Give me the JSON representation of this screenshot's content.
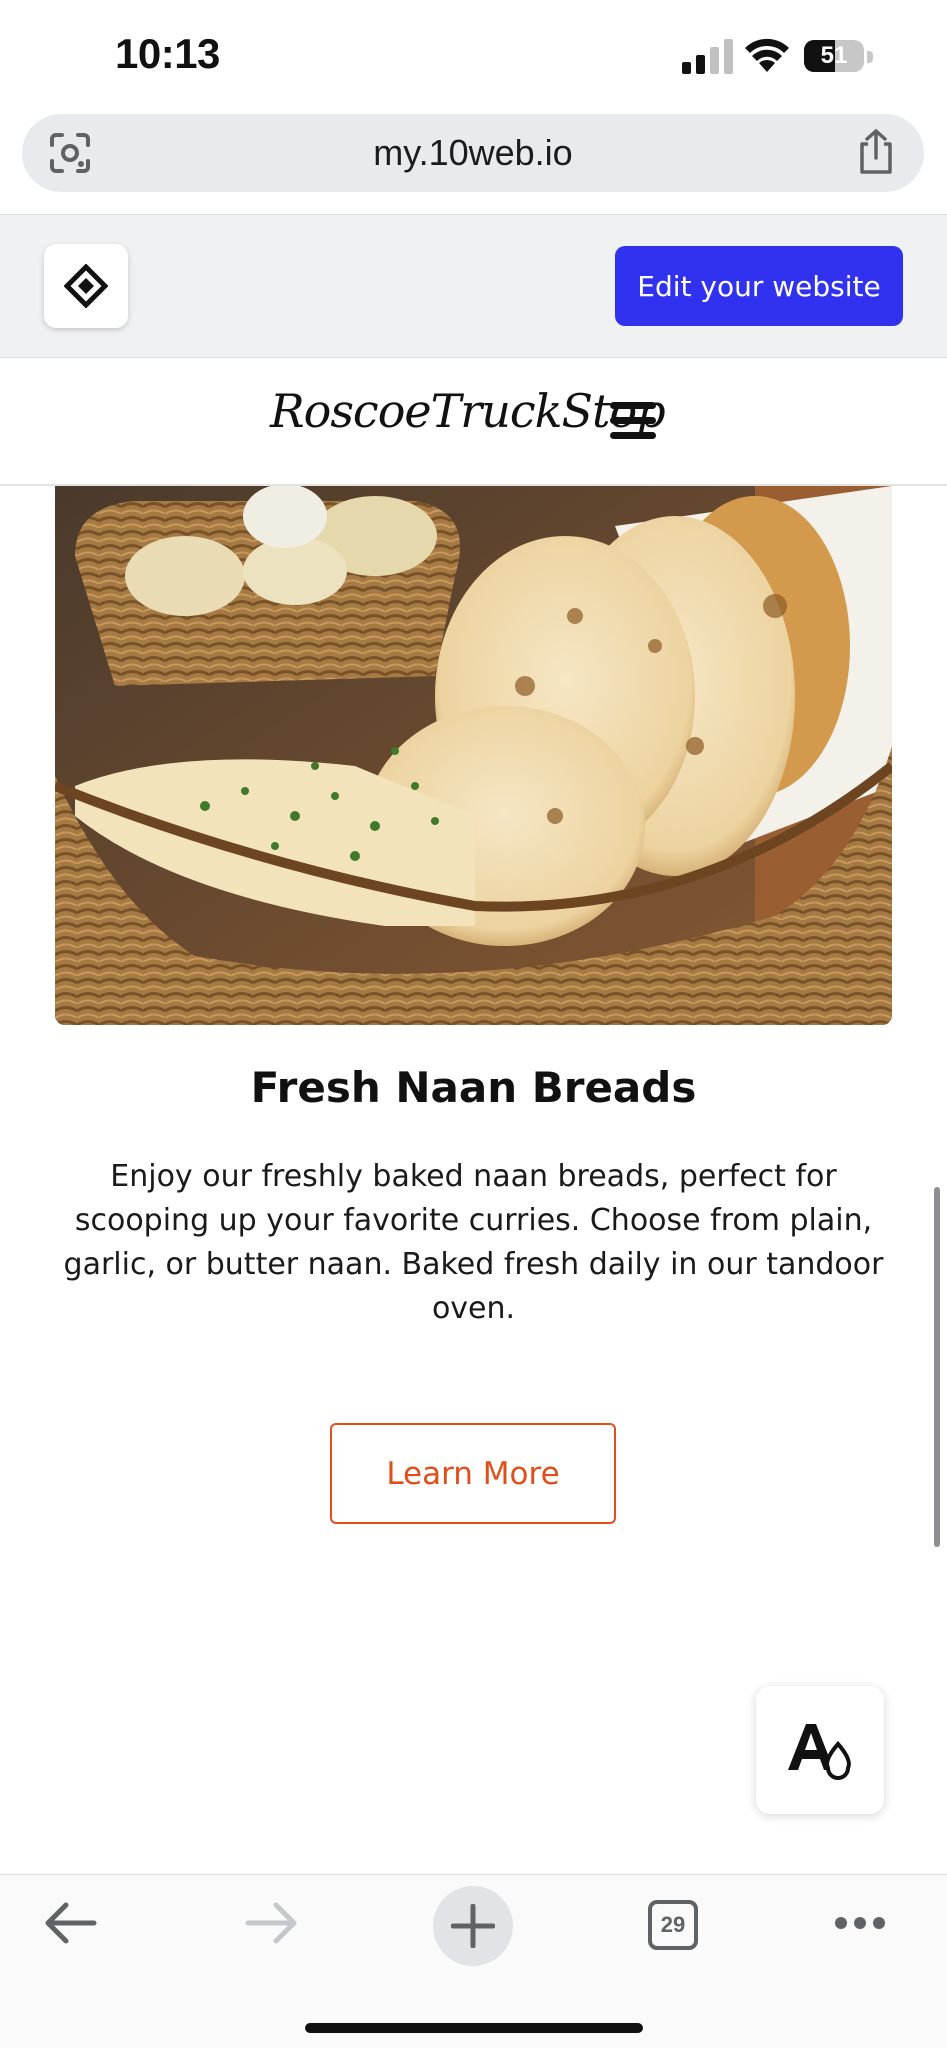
{
  "status_bar": {
    "time": "10:13",
    "battery_level": "51",
    "icons": [
      "cellular-signal-icon",
      "wifi-icon",
      "battery-icon"
    ]
  },
  "browser": {
    "url": "my.10web.io",
    "icons": [
      "lens-icon",
      "share-icon"
    ]
  },
  "tenweb_bar": {
    "logo_icon": "tenweb-diamond-logo-icon",
    "edit_button_label": "Edit your website",
    "accent_color": "#3131f0"
  },
  "site": {
    "logo_text": "RoscoeTruckStop",
    "menu_icon": "hamburger-menu-icon"
  },
  "content": {
    "hero_image": "naan-breads-basket-photo",
    "title": "Fresh Naan Breads",
    "description": "Enjoy our freshly baked naan breads, perfect for scooping up your favorite curries. Choose from plain, garlic, or butter naan. Baked fresh daily in our tandoor oven.",
    "cta_label": "Learn More",
    "cta_color": "#e04f1a"
  },
  "floating_button": {
    "icon": "font-color-drop-icon"
  },
  "toolbar": {
    "tab_count": "29",
    "icons": [
      "back-arrow-icon",
      "forward-arrow-icon",
      "plus-icon",
      "tabs-icon",
      "more-dots-icon"
    ]
  }
}
